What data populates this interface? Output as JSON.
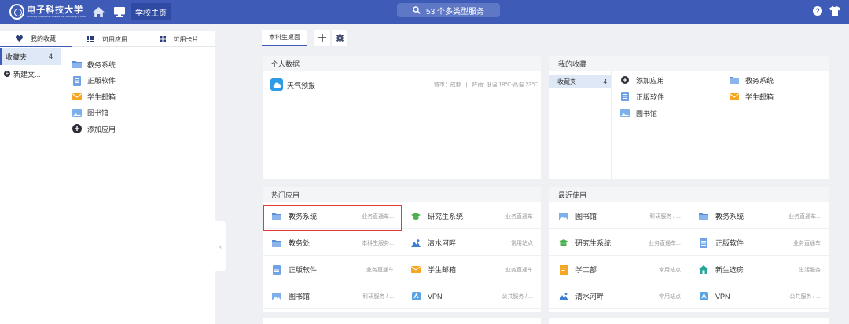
{
  "topbar": {
    "logo_cn": "电子科技大学",
    "logo_en": "University of Electronic Science and Technology of China",
    "active_tab": "学校主页",
    "search_text": "53 个多类型服务"
  },
  "left": {
    "tabs": [
      "我的收藏",
      "可用应用",
      "可用卡片"
    ],
    "categories": [
      {
        "label": "收藏夹",
        "count": "4"
      },
      {
        "label": "新建文..."
      }
    ],
    "apps": [
      "教务系统",
      "正版软件",
      "学生邮箱",
      "图书馆",
      "添加应用"
    ]
  },
  "desk": {
    "tab_label": "本科生桌面"
  },
  "personal": {
    "title": "个人数据",
    "weather_name": "天气预报",
    "city": "城市：成都",
    "sep": "|",
    "weather": "阵雨: 低温 18℃-高温 23℃"
  },
  "favorites": {
    "title": "我的收藏",
    "category": "收藏夹",
    "count": "4",
    "apps": [
      "添加应用",
      "教务系统",
      "正版软件",
      "学生邮箱",
      "图书馆"
    ]
  },
  "hot": {
    "title": "热门应用",
    "apps": [
      {
        "name": "教务系统",
        "cat": "业务直通车..."
      },
      {
        "name": "研究生系统",
        "cat": "业务直通车"
      },
      {
        "name": "教务处",
        "cat": "本科生服务..."
      },
      {
        "name": "清水河畔",
        "cat": "常用站点"
      },
      {
        "name": "正版软件",
        "cat": "业务直通车"
      },
      {
        "name": "学生邮箱",
        "cat": "业务直通车"
      },
      {
        "name": "图书馆",
        "cat": "科研服务 / ..."
      },
      {
        "name": "VPN",
        "cat": "公共服务 / ..."
      }
    ]
  },
  "recent": {
    "title": "最近使用",
    "apps": [
      {
        "name": "图书馆",
        "cat": "科研服务 / ..."
      },
      {
        "name": "教务系统",
        "cat": "业务直通车..."
      },
      {
        "name": "研究生系统",
        "cat": "业务直通车..."
      },
      {
        "name": "正版软件",
        "cat": "业务直通车"
      },
      {
        "name": "学工部",
        "cat": "常用站点"
      },
      {
        "name": "新生选房",
        "cat": "生活服务"
      },
      {
        "name": "清水河畔",
        "cat": "常用站点"
      },
      {
        "name": "VPN",
        "cat": "公共服务 / ..."
      }
    ]
  },
  "colors": {
    "accent": "#3e5bb8",
    "highlight": "#e53935"
  }
}
